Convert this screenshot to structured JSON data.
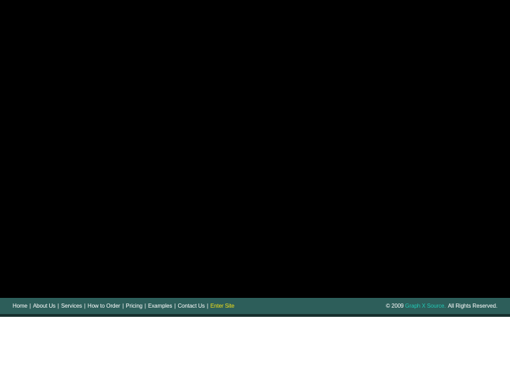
{
  "nav": {
    "items": [
      {
        "label": "Home"
      },
      {
        "label": "About Us"
      },
      {
        "label": "Services"
      },
      {
        "label": "How to Order"
      },
      {
        "label": "Pricing"
      },
      {
        "label": "Examples"
      },
      {
        "label": "Contact Us"
      },
      {
        "label": "Enter Site"
      }
    ],
    "separator": "|"
  },
  "footer": {
    "copyright_prefix": "© 2009",
    "brand": "Graph X Source.",
    "rights": "All Rights Reserved."
  },
  "colors": {
    "hero_bg": "#000000",
    "footer_bg": "#2d5e5a",
    "nav_text": "#ffffff",
    "enter_site": "#f2e11a",
    "brand_link": "#22c7b4"
  }
}
